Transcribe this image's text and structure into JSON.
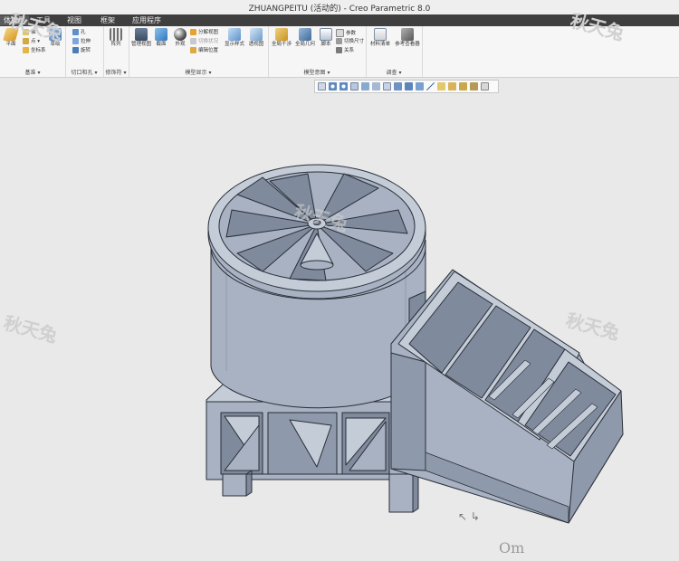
{
  "window": {
    "title": "ZHUANGPEITU (活动的) - Creo Parametric 8.0"
  },
  "menu": {
    "items": [
      "体模型",
      "工具",
      "视图",
      "框架",
      "应用程序"
    ]
  },
  "ribbon": {
    "datum": {
      "plane": "平面",
      "axis": "轴",
      "point": "点 ▾",
      "csys": "坐标系",
      "sketch": "草绘",
      "label": "基准 ▾"
    },
    "cut": {
      "hole": "孔",
      "extrude": "拉伸",
      "revolve": "旋转",
      "label": "切口和孔 ▾"
    },
    "modifiers": {
      "pattern": "阵列",
      "label": "修饰符 ▾"
    },
    "display": {
      "manage_views": "管理视图",
      "section": "截面",
      "perspective": "外观",
      "explode": "分解视图",
      "toggle_state": "切换状况",
      "edit_position": "编辑位置",
      "display_style": "显示样式",
      "saved_views": "透视图",
      "label": "模型显示 ▾"
    },
    "interference": {
      "global_interference": "全局干涉",
      "global_geometry": "全局几何",
      "reference_status": "脚本",
      "parameters": "参数",
      "switch_dims": "切换尺寸",
      "relations": "关系",
      "label": "模型意图 ▾"
    },
    "investigate": {
      "bill_materials": "材料清单",
      "ref_viewer": "参考查看器",
      "label": "调查 ▾"
    }
  },
  "colors": {
    "background": "#e9e9e9",
    "model": "#a8b2c3",
    "model_dark": "#7f8a9d",
    "model_light": "#c4ccd8",
    "outline": "#2a2f38",
    "menubar": "#3f3f3f"
  },
  "watermark": {
    "text": "秋天兔"
  },
  "canvas_text": {
    "om": "Om",
    "spin": "↖ ↳"
  }
}
